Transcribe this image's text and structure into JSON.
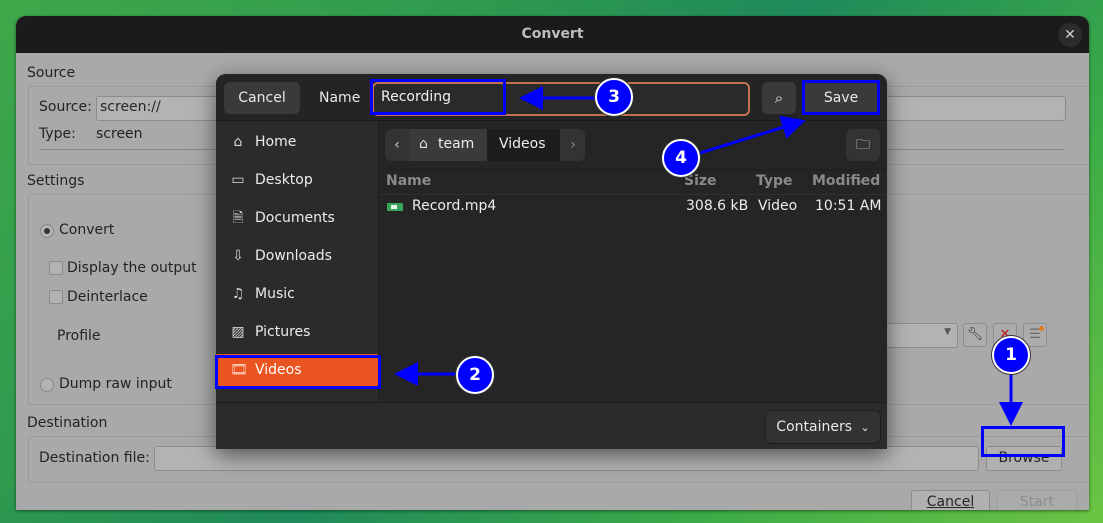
{
  "window": {
    "title": "Convert",
    "close_icon": "close-icon"
  },
  "source": {
    "section_label": "Source",
    "source_label": "Source:",
    "source_value": "screen://",
    "type_label": "Type:",
    "type_value": "screen"
  },
  "settings": {
    "section_label": "Settings",
    "convert_label": "Convert",
    "convert_selected": true,
    "display_output_label": "Display the output",
    "display_output_checked": false,
    "deinterlace_label": "Deinterlace",
    "deinterlace_checked": false,
    "profile_label": "Profile",
    "profile_value": "",
    "dump_raw_label": "Dump raw input",
    "dump_raw_selected": false,
    "profile_edit_icon": "wrench-icon",
    "profile_delete_icon": "red-x-icon",
    "profile_new_icon": "new-profile-icon"
  },
  "destination": {
    "section_label": "Destination",
    "file_label": "Destination file:",
    "file_value": "",
    "browse_label": "Browse"
  },
  "actions": {
    "cancel_label": "Cancel",
    "start_label": "Start"
  },
  "file_dialog": {
    "cancel_label": "Cancel",
    "name_label": "Name",
    "name_value": "Recording",
    "save_label": "Save",
    "search_icon": "search-icon",
    "breadcrumbs": [
      {
        "label": "team",
        "icon": "home-icon"
      },
      {
        "label": "Videos"
      }
    ],
    "new_folder_icon": "new-folder-icon",
    "sidebar": [
      {
        "label": "Home",
        "icon": "home-icon"
      },
      {
        "label": "Desktop",
        "icon": "desktop-icon"
      },
      {
        "label": "Documents",
        "icon": "document-icon"
      },
      {
        "label": "Downloads",
        "icon": "download-icon"
      },
      {
        "label": "Music",
        "icon": "music-icon"
      },
      {
        "label": "Pictures",
        "icon": "picture-icon"
      },
      {
        "label": "Videos",
        "icon": "video-icon",
        "selected": true
      }
    ],
    "columns": [
      "Name",
      "Size",
      "Type",
      "Modified"
    ],
    "files": [
      {
        "name": "Record.mp4",
        "size": "308.6 kB",
        "type": "Video",
        "modified": "10:51 AM"
      }
    ],
    "filter_label": "Containers"
  },
  "annotations": [
    {
      "number": "1",
      "target": "Browse button"
    },
    {
      "number": "2",
      "target": "Videos sidebar item"
    },
    {
      "number": "3",
      "target": "Name field"
    },
    {
      "number": "4",
      "target": "Save button"
    }
  ],
  "colors": {
    "accent": "#e95420",
    "annotation": "#0000ff"
  }
}
